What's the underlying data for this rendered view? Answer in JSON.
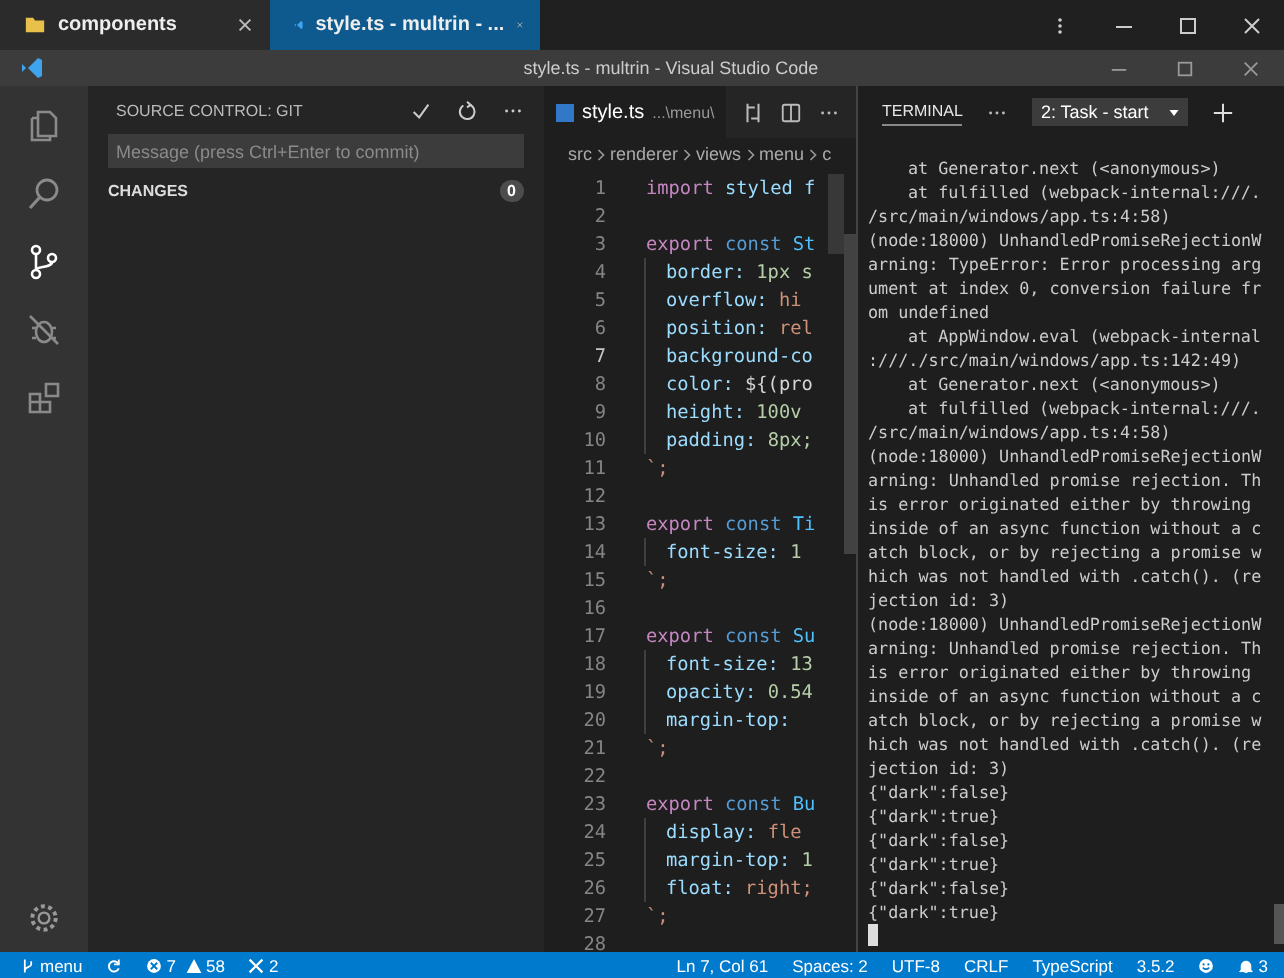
{
  "browser_tabs": [
    {
      "label": "components",
      "kind": "folder",
      "selected": false
    },
    {
      "label": "style.ts - multrin - ...",
      "kind": "editor",
      "selected": true
    }
  ],
  "window": {
    "title": "style.ts - multrin - Visual Studio Code"
  },
  "activity_bar": [
    {
      "kind": "files",
      "selected": false
    },
    {
      "kind": "search",
      "selected": false
    },
    {
      "kind": "source-control",
      "selected": true
    },
    {
      "kind": "debug",
      "selected": false
    },
    {
      "kind": "extensions",
      "selected": false
    }
  ],
  "sidebar": {
    "title": "SOURCE CONTROL: GIT",
    "message": {
      "placeholder": "Message (press Ctrl+Enter to commit)"
    },
    "changes": {
      "label": "CHANGES",
      "count": "0"
    }
  },
  "editor": {
    "tab": {
      "label": "style.ts",
      "path": "...\\menu\\"
    },
    "breadcrumbs": [
      "src",
      "renderer",
      "views",
      "menu",
      "c"
    ],
    "lines": [
      {
        "number": "1",
        "current": false,
        "indented": false,
        "tokens": [
          {
            "text": "import ",
            "kind": "keyword"
          },
          {
            "text": "styled f",
            "kind": "variable"
          }
        ]
      },
      {
        "number": "2",
        "current": false,
        "indented": false
      },
      {
        "number": "3",
        "current": false,
        "indented": false,
        "tokens": [
          {
            "text": "export ",
            "kind": "keyword"
          },
          {
            "text": "const ",
            "kind": "storage"
          },
          {
            "text": "St",
            "kind": "constant"
          }
        ]
      },
      {
        "number": "4",
        "current": false,
        "indented": true,
        "tokens": [
          {
            "text": "border: ",
            "kind": "property"
          },
          {
            "text": "1px s",
            "kind": "number"
          }
        ]
      },
      {
        "number": "5",
        "current": false,
        "indented": true,
        "tokens": [
          {
            "text": "overflow: ",
            "kind": "property"
          },
          {
            "text": "hi",
            "kind": "value"
          }
        ]
      },
      {
        "number": "6",
        "current": false,
        "indented": true,
        "tokens": [
          {
            "text": "position: ",
            "kind": "property"
          },
          {
            "text": "rel",
            "kind": "value"
          }
        ]
      },
      {
        "number": "7",
        "current": true,
        "indented": true,
        "tokens": [
          {
            "text": "background-co",
            "kind": "property"
          }
        ]
      },
      {
        "number": "8",
        "current": false,
        "indented": true,
        "tokens": [
          {
            "text": "color: ",
            "kind": "property"
          },
          {
            "text": "${(pro",
            "kind": "plain"
          }
        ]
      },
      {
        "number": "9",
        "current": false,
        "indented": true,
        "tokens": [
          {
            "text": "height: ",
            "kind": "property"
          },
          {
            "text": "100v",
            "kind": "number"
          }
        ]
      },
      {
        "number": "10",
        "current": false,
        "indented": true,
        "tokens": [
          {
            "text": "padding: ",
            "kind": "property"
          },
          {
            "text": "8px;",
            "kind": "number"
          }
        ]
      },
      {
        "number": "11",
        "current": false,
        "indented": false,
        "tokens": [
          {
            "text": "`;",
            "kind": "value"
          }
        ]
      },
      {
        "number": "12",
        "current": false,
        "indented": false
      },
      {
        "number": "13",
        "current": false,
        "indented": false,
        "tokens": [
          {
            "text": "export ",
            "kind": "keyword"
          },
          {
            "text": "const ",
            "kind": "storage"
          },
          {
            "text": "Ti",
            "kind": "constant"
          }
        ]
      },
      {
        "number": "14",
        "current": false,
        "indented": true,
        "tokens": [
          {
            "text": "font-size: ",
            "kind": "property"
          },
          {
            "text": "1",
            "kind": "number"
          }
        ]
      },
      {
        "number": "15",
        "current": false,
        "indented": false,
        "tokens": [
          {
            "text": "`;",
            "kind": "value"
          }
        ]
      },
      {
        "number": "16",
        "current": false,
        "indented": false
      },
      {
        "number": "17",
        "current": false,
        "indented": false,
        "tokens": [
          {
            "text": "export ",
            "kind": "keyword"
          },
          {
            "text": "const ",
            "kind": "storage"
          },
          {
            "text": "Su",
            "kind": "constant"
          }
        ]
      },
      {
        "number": "18",
        "current": false,
        "indented": true,
        "tokens": [
          {
            "text": "font-size: ",
            "kind": "property"
          },
          {
            "text": "13",
            "kind": "number"
          }
        ]
      },
      {
        "number": "19",
        "current": false,
        "indented": true,
        "tokens": [
          {
            "text": "opacity: ",
            "kind": "property"
          },
          {
            "text": "0.54",
            "kind": "number"
          }
        ]
      },
      {
        "number": "20",
        "current": false,
        "indented": true,
        "tokens": [
          {
            "text": "margin-top: ",
            "kind": "property"
          }
        ]
      },
      {
        "number": "21",
        "current": false,
        "indented": false,
        "tokens": [
          {
            "text": "`;",
            "kind": "value"
          }
        ]
      },
      {
        "number": "22",
        "current": false,
        "indented": false
      },
      {
        "number": "23",
        "current": false,
        "indented": false,
        "tokens": [
          {
            "text": "export ",
            "kind": "keyword"
          },
          {
            "text": "const ",
            "kind": "storage"
          },
          {
            "text": "Bu",
            "kind": "constant"
          }
        ]
      },
      {
        "number": "24",
        "current": false,
        "indented": true,
        "tokens": [
          {
            "text": "display: ",
            "kind": "property"
          },
          {
            "text": "fle",
            "kind": "value"
          }
        ]
      },
      {
        "number": "25",
        "current": false,
        "indented": true,
        "tokens": [
          {
            "text": "margin-top: ",
            "kind": "property"
          },
          {
            "text": "1",
            "kind": "number"
          }
        ]
      },
      {
        "number": "26",
        "current": false,
        "indented": true,
        "tokens": [
          {
            "text": "float: ",
            "kind": "property"
          },
          {
            "text": "right;",
            "kind": "value"
          }
        ]
      },
      {
        "number": "27",
        "current": false,
        "indented": false,
        "tokens": [
          {
            "text": "`;",
            "kind": "value"
          }
        ]
      },
      {
        "number": "28",
        "current": false,
        "indented": false
      }
    ]
  },
  "terminal": {
    "title": "TERMINAL",
    "task": "2: Task - start",
    "lines": [
      {
        "text": "at Generator.next (<anonymous>)",
        "indented": true
      },
      {
        "text": "at fulfilled (webpack-internal:///.",
        "indented": true
      },
      {
        "text": "/src/main/windows/app.ts:4:58)",
        "indented": false
      },
      {
        "text": "(node:18000) UnhandledPromiseRejectionW",
        "indented": false
      },
      {
        "text": "arning: TypeError: Error processing arg",
        "indented": false
      },
      {
        "text": "ument at index 0, conversion failure fr",
        "indented": false
      },
      {
        "text": "om undefined",
        "indented": false
      },
      {
        "text": "at AppWindow.eval (webpack-internal",
        "indented": true
      },
      {
        "text": ":///./src/main/windows/app.ts:142:49)",
        "indented": false
      },
      {
        "text": "at Generator.next (<anonymous>)",
        "indented": true
      },
      {
        "text": "at fulfilled (webpack-internal:///.",
        "indented": true
      },
      {
        "text": "/src/main/windows/app.ts:4:58)",
        "indented": false
      },
      {
        "text": "(node:18000) UnhandledPromiseRejectionW",
        "indented": false
      },
      {
        "text": "arning: Unhandled promise rejection. Th",
        "indented": false
      },
      {
        "text": "is error originated either by throwing",
        "indented": false
      },
      {
        "text": "inside of an async function without a c",
        "indented": false
      },
      {
        "text": "atch block, or by rejecting a promise w",
        "indented": false
      },
      {
        "text": "hich was not handled with .catch(). (re",
        "indented": false
      },
      {
        "text": "jection id: 3)",
        "indented": false
      },
      {
        "text": "(node:18000) UnhandledPromiseRejectionW",
        "indented": false
      },
      {
        "text": "arning: Unhandled promise rejection. Th",
        "indented": false
      },
      {
        "text": "is error originated either by throwing",
        "indented": false
      },
      {
        "text": "inside of an async function without a c",
        "indented": false
      },
      {
        "text": "atch block, or by rejecting a promise w",
        "indented": false
      },
      {
        "text": "hich was not handled with .catch(). (re",
        "indented": false
      },
      {
        "text": "jection id: 3)",
        "indented": false
      },
      {
        "text": "{\"dark\":false}",
        "indented": false
      },
      {
        "text": "{\"dark\":true}",
        "indented": false
      },
      {
        "text": "{\"dark\":false}",
        "indented": false
      },
      {
        "text": "{\"dark\":true}",
        "indented": false
      },
      {
        "text": "{\"dark\":false}",
        "indented": false
      },
      {
        "text": "{\"dark\":true}",
        "indented": false
      }
    ]
  },
  "status_bar": {
    "branch": "menu",
    "errors": "7",
    "warnings": "58",
    "tools": "2",
    "items": [
      "Ln 7, Col 61",
      "Spaces: 2",
      "UTF-8",
      "CRLF",
      "TypeScript",
      "3.5.2"
    ],
    "notifications": "3"
  }
}
